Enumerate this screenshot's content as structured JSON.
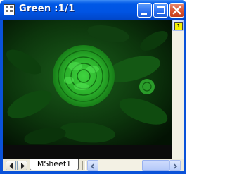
{
  "window": {
    "title": "Green :1/1",
    "icons": {
      "app": "worksheet-icon",
      "minimize": "minimize-icon",
      "maximize": "maximize-icon",
      "close": "close-icon",
      "layer": "layer-icon"
    }
  },
  "layer_indicator": {
    "label": "1"
  },
  "sheet_tabs": [
    {
      "label": "MSheet1",
      "active": true
    }
  ],
  "colors": {
    "title_bar": "#0054e3",
    "close_button": "#d9532f",
    "image_tint": "#1f8a1f"
  }
}
